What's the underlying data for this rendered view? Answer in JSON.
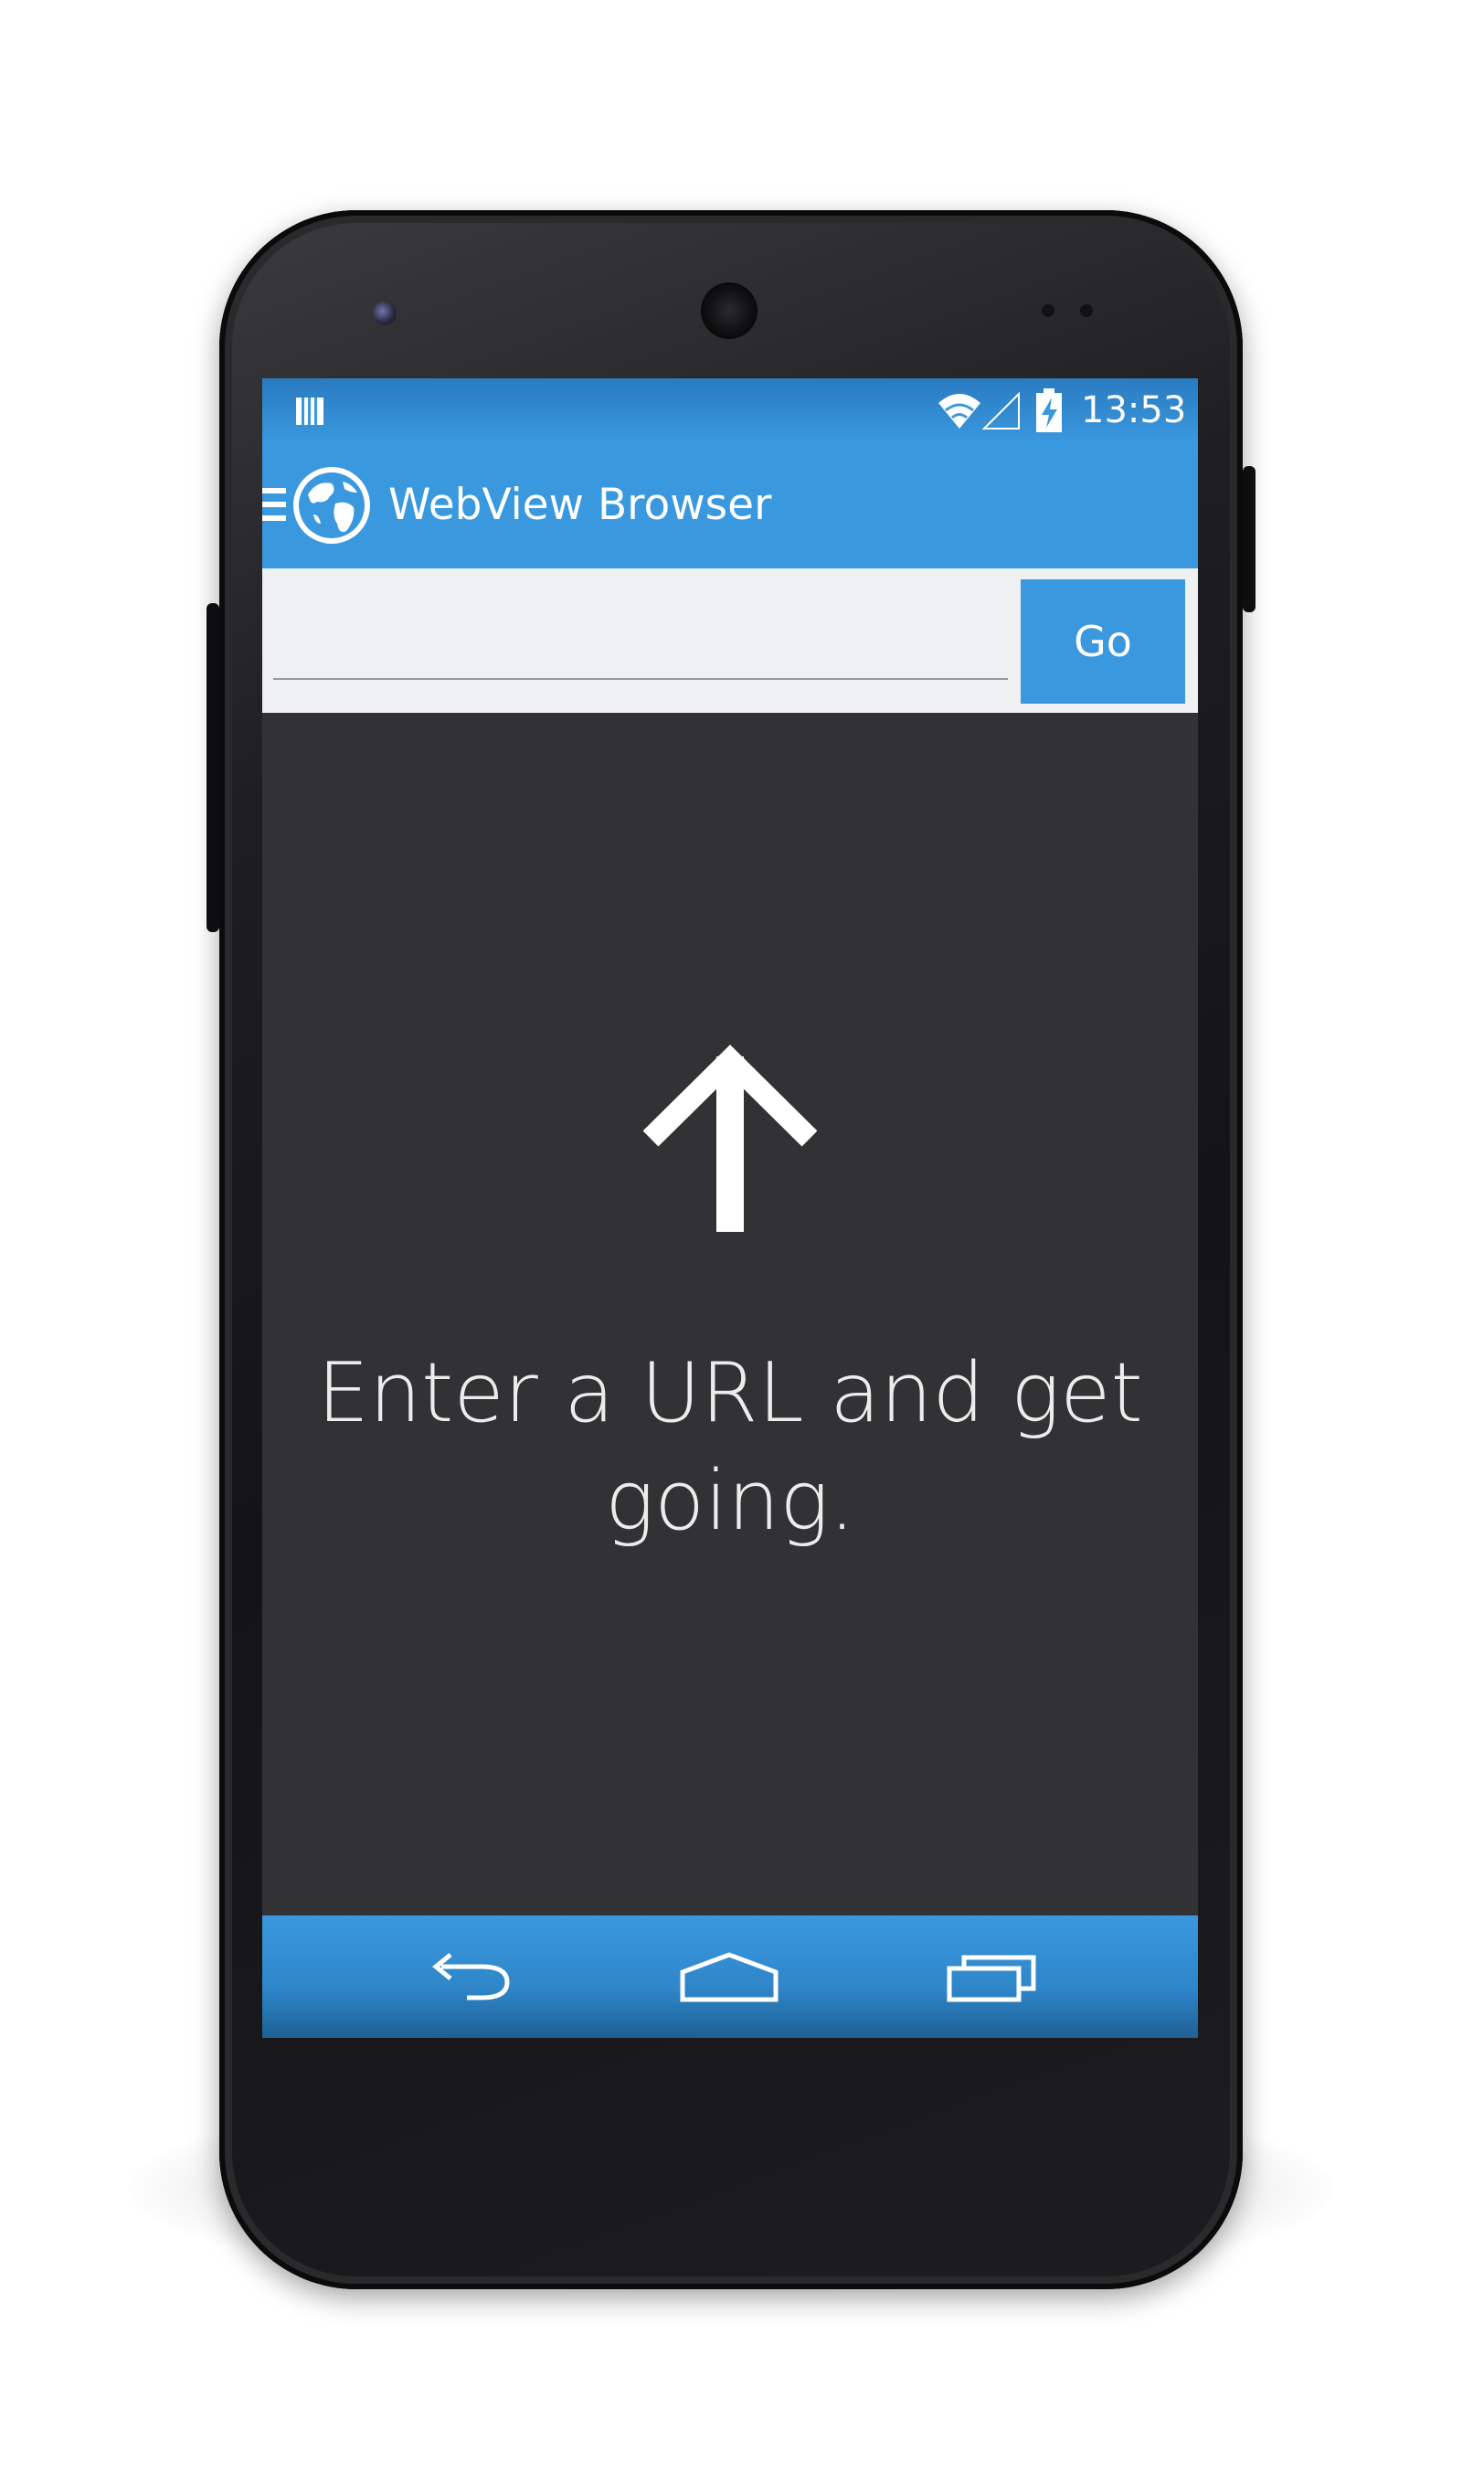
{
  "status_bar": {
    "time": "13:53",
    "icons": [
      "notification-icon",
      "wifi-icon",
      "signal-icon",
      "battery-charging-icon"
    ]
  },
  "action_bar": {
    "title": "WebView Browser",
    "icons": [
      "menu-icon",
      "globe-icon"
    ]
  },
  "url_bar": {
    "value": "",
    "placeholder": "",
    "go_label": "Go"
  },
  "content": {
    "hint_icon": "arrow-up-icon",
    "message": "Enter a URL and get going."
  },
  "nav_bar": {
    "icons": [
      "back-icon",
      "home-icon",
      "recent-apps-icon"
    ]
  },
  "colors": {
    "accent": "#3a98de",
    "screen_background": "#323235",
    "input_background": "#eef0f2",
    "text_light": "#ececec"
  }
}
